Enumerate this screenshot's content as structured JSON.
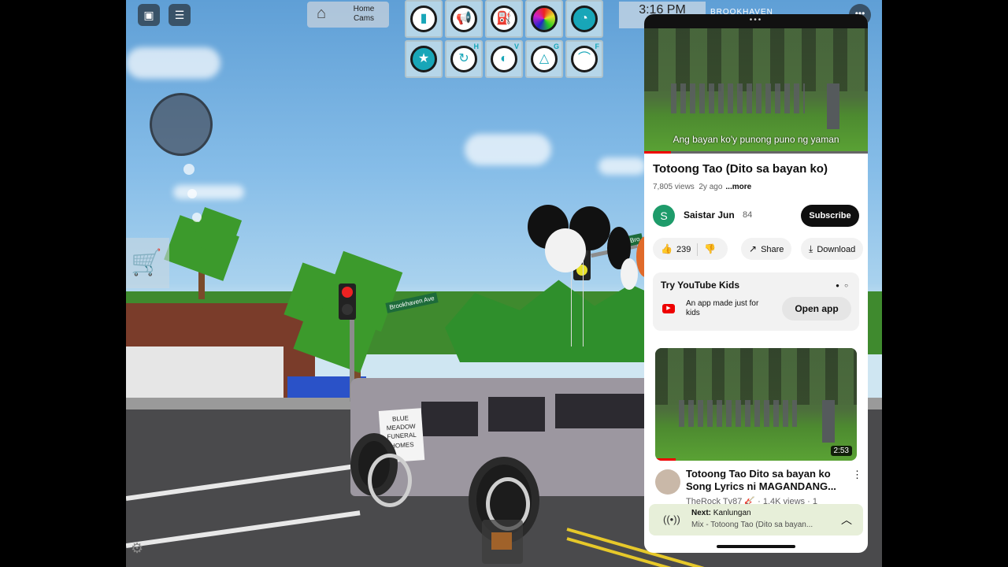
{
  "game": {
    "home_cams_label": "Home\nCams",
    "clock": "3:16 PM",
    "place_name": "BROOKHAVEN",
    "street_sign_1": "Brookhaven Ave",
    "street_sign_2": "Bro",
    "car_sign": "BLUE MEADOW FUNERAL HOMES",
    "tools": [
      {
        "name": "speaker-icon",
        "key": ""
      },
      {
        "name": "megaphone-icon",
        "key": ""
      },
      {
        "name": "gas-pump-icon",
        "key": ""
      },
      {
        "name": "color-wheel-icon",
        "key": ""
      },
      {
        "name": "speedometer-icon",
        "key": ""
      },
      {
        "name": "star-icon",
        "key": ""
      },
      {
        "name": "drift-icon",
        "key": "H"
      },
      {
        "name": "headlight-icon",
        "key": "V"
      },
      {
        "name": "hazard-icon",
        "key": "G"
      },
      {
        "name": "horn-icon",
        "key": "F"
      }
    ]
  },
  "youtube": {
    "video_caption": "Ang bayan ko'y punong puno ng yaman",
    "progress_fraction": 0.12,
    "title": "Totoong Tao (Dito sa bayan ko)",
    "views": "7,805 views",
    "age": "2y ago",
    "more": "...more",
    "channel_initial": "S",
    "channel_name": "Saistar Jun",
    "subscribers": "84",
    "subscribe_label": "Subscribe",
    "likes": "239",
    "share_label": "Share",
    "download_label": "Download",
    "kids_card": {
      "title": "Try YouTube Kids",
      "description": "An app made just for kids",
      "button": "Open app"
    },
    "recommended": {
      "duration": "2:53",
      "title_line1": "Totoong Tao Dito sa bayan ko",
      "title_line2": "Song Lyrics ni MAGANDANG...",
      "meta": "TheRock Tv87 🎸 · 1.4K views · 1",
      "progress_fraction": 0.1
    },
    "next": {
      "label": "Next:",
      "title": "Kanlungan",
      "subtitle": "Mix - Totoong Tao (Dito sa bayan..."
    }
  }
}
